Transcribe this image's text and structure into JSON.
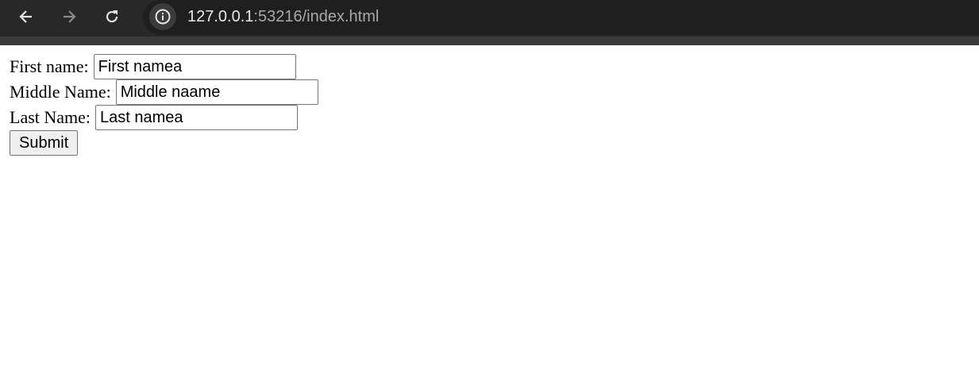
{
  "browser": {
    "url_host": "127.0.0.1",
    "url_rest": ":53216/index.html"
  },
  "form": {
    "first_name_label": "First name:",
    "first_name_value": "First namea",
    "middle_name_label": "Middle Name:",
    "middle_name_value": "Middle naame",
    "last_name_label": "Last Name:",
    "last_name_value": "Last namea",
    "submit_label": "Submit"
  },
  "colors": {
    "toolbar": "#282828",
    "omnibox": "#1f1f1f",
    "page_background": "#ffffff"
  }
}
